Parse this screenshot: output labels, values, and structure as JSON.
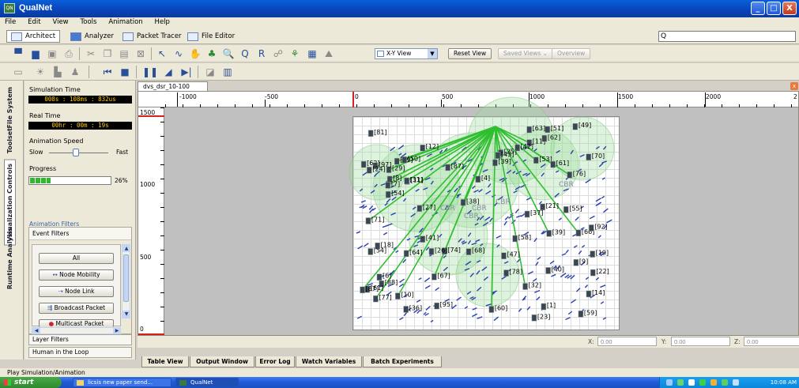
{
  "window": {
    "title": "QualNet",
    "minimize": "_",
    "maximize": "□",
    "close": "X"
  },
  "menu": [
    "File",
    "Edit",
    "View",
    "Tools",
    "Animation",
    "Help"
  ],
  "app_tabs": [
    "Architect",
    "Analyzer",
    "Packet Tracer",
    "File Editor"
  ],
  "search": {
    "icon": "Q",
    "value": ""
  },
  "toolbar1": {
    "view_select": "X-Y View",
    "reset_view": "Reset View",
    "saved_views": "Saved Views",
    "overview": "Overview"
  },
  "side_tabs": [
    "File System",
    "Toolset",
    "Visualization Controls",
    "Runtime Analysis"
  ],
  "panel": {
    "sim_time_label": "Simulation Time",
    "sim_time_value": "008s : 108ms : 832us",
    "real_time_label": "Real Time",
    "real_time_value": "00hr : 00m : 19s",
    "anim_speed_label": "Animation Speed",
    "slow": "Slow",
    "fast": "Fast",
    "anim_speed_level": 0.45,
    "progress_label": "Progress",
    "progress_value": 0.26,
    "progress_pct": "26%",
    "filters_header": "Animation Filters",
    "event_filters": "Event Filters",
    "filter_buttons": [
      "All",
      "Node Mobility",
      "Node Link",
      "Broadcast Packet",
      "Multicast Packet"
    ],
    "layer_filters": "Layer Filters",
    "human_in_loop": "Human in the Loop"
  },
  "doc_tab": "dvs_dsr_10-100",
  "ruler": {
    "x_ticks": [
      "-1000",
      "-500",
      "0",
      "500",
      "1000",
      "1500",
      "2000",
      "2"
    ],
    "y_ticks": [
      "1500",
      "1000",
      "500",
      "0"
    ]
  },
  "nodes": [
    "51",
    "21",
    "39",
    "76",
    "68",
    "1",
    "88",
    "74",
    "53",
    "63",
    "40",
    "54",
    "29",
    "8",
    "19",
    "78",
    "58",
    "66",
    "60",
    "23",
    "64",
    "12",
    "32",
    "7",
    "18",
    "55",
    "61",
    "67",
    "25",
    "41",
    "95",
    "11",
    "10",
    "38",
    "62",
    "81",
    "92",
    "87",
    "27",
    "26",
    "47",
    "54",
    "11",
    "77",
    "70",
    "39",
    "97",
    "99",
    "31",
    "59",
    "22",
    "9",
    "71",
    "61",
    "6",
    "42",
    "14",
    "87",
    "50",
    "62",
    "24",
    "49",
    "43",
    "4",
    "36",
    "37"
  ],
  "labels": {
    "cbr": "CBR"
  },
  "coords": {
    "x_label": "X:",
    "x_value": "0.00",
    "y_label": "Y:",
    "y_value": "0.00",
    "z_label": "Z:",
    "z_value": "0.00"
  },
  "bottom_tabs": [
    "Table View",
    "Output Window",
    "Error Log",
    "Watch Variables",
    "Batch Experiments"
  ],
  "status": "Play Simulation/Animation",
  "taskbar": {
    "start": "start",
    "items": [
      "licsis new paper send...",
      "QualNet"
    ],
    "clock": "10:08 AM"
  }
}
